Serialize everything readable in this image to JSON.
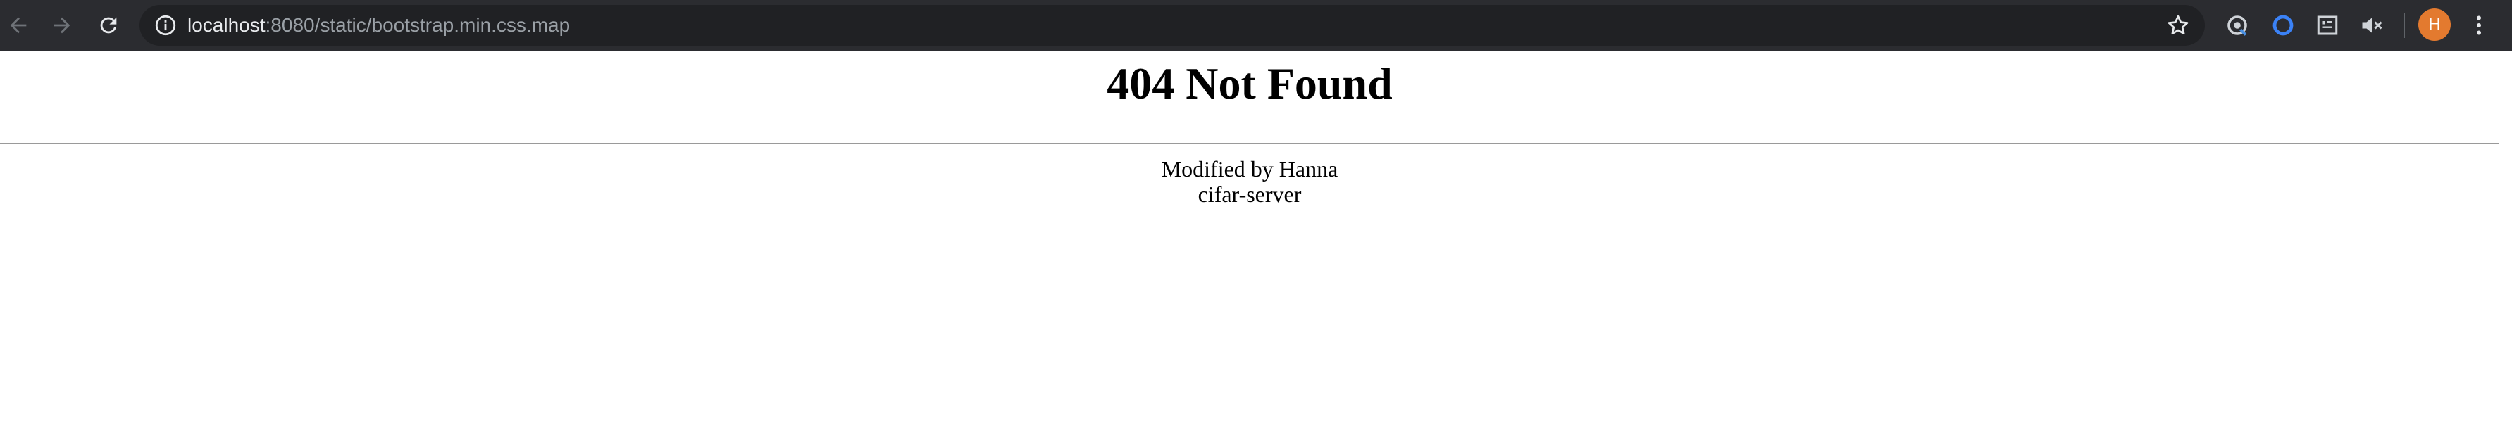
{
  "browser": {
    "url_host": "localhost",
    "url_rest": ":8080/static/bootstrap.min.css.map",
    "profile_initial": "H",
    "colors": {
      "toolbar": "#2b2c30",
      "omnibox": "#202124",
      "avatar": "#e37a2f"
    },
    "icons": [
      "back-arrow-icon",
      "forward-arrow-icon",
      "reload-icon",
      "info-icon",
      "star-icon",
      "extension-icon-1",
      "extension-icon-2",
      "extension-icon-3",
      "mute-icon",
      "kebab-menu-icon"
    ]
  },
  "page": {
    "title": "404 Not Found",
    "footer_line1": "Modified by Hanna",
    "footer_line2": "cifar-server"
  }
}
